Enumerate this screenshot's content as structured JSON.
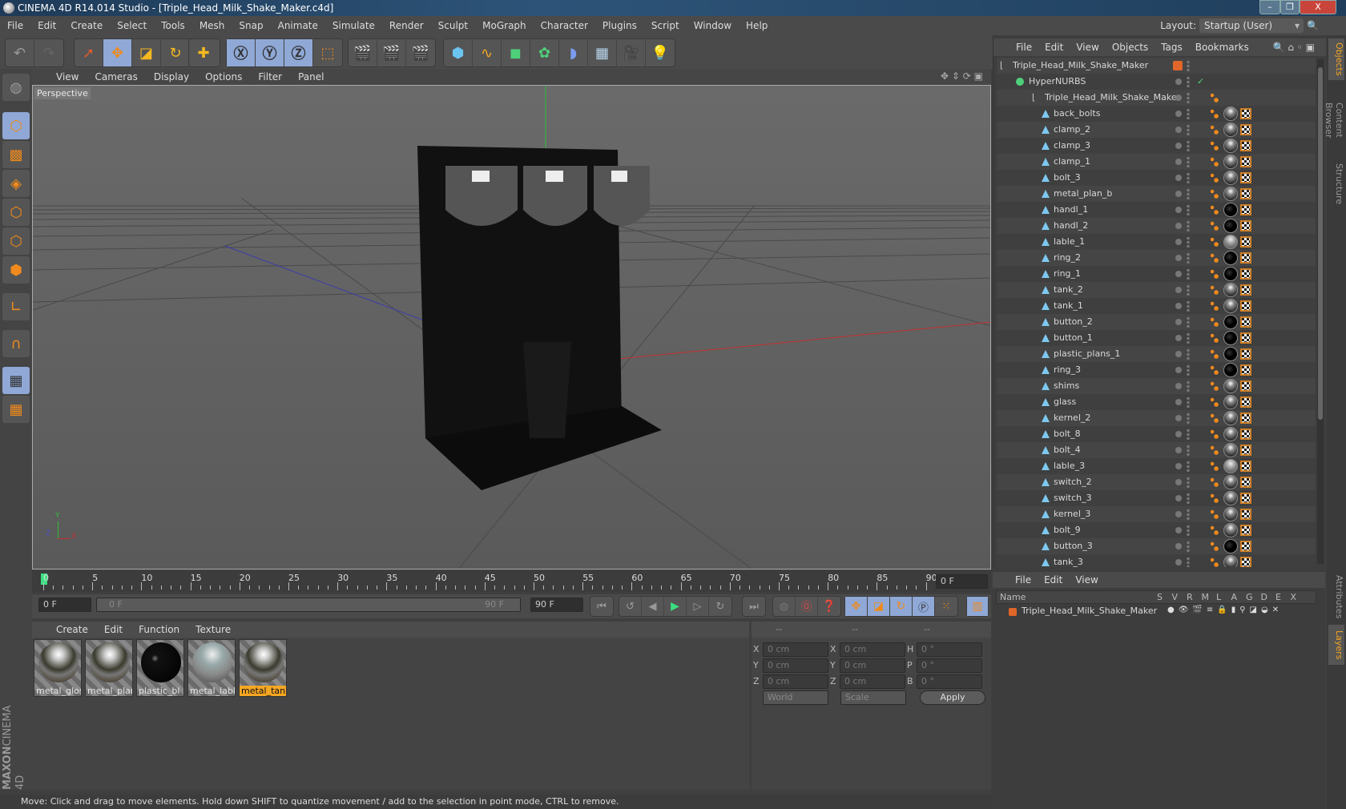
{
  "window": {
    "title": "CINEMA 4D R14.014 Studio - [Triple_Head_Milk_Shake_Maker.c4d]",
    "controls": [
      "minimize",
      "restore",
      "close"
    ]
  },
  "menubar": [
    "File",
    "Edit",
    "Create",
    "Select",
    "Tools",
    "Mesh",
    "Snap",
    "Animate",
    "Simulate",
    "Render",
    "Sculpt",
    "MoGraph",
    "Character",
    "Plugins",
    "Script",
    "Window",
    "Help"
  ],
  "layout": {
    "label": "Layout:",
    "value": "Startup (User)"
  },
  "toolbar": {
    "icons": [
      "undo-icon",
      "redo-icon",
      "live-selection-icon",
      "move-icon",
      "scale-icon",
      "rotate-icon",
      "add-icon",
      "x-axis-icon",
      "y-axis-icon",
      "z-axis-icon",
      "coordinate-system-icon",
      "render-view-icon",
      "render-picture-viewer-icon",
      "render-settings-icon",
      "cube-icon",
      "spline-icon",
      "nurbs-icon",
      "array-icon",
      "deformer-icon",
      "floor-icon",
      "camera-icon",
      "light-icon"
    ]
  },
  "viewport": {
    "menu": [
      "View",
      "Cameras",
      "Display",
      "Options",
      "Filter",
      "Panel"
    ],
    "label": "Perspective",
    "axes": {
      "x": "X",
      "y": "Y",
      "z": "Z"
    }
  },
  "timeline": {
    "ticks": [
      "0",
      "5",
      "10",
      "15",
      "20",
      "25",
      "30",
      "35",
      "40",
      "45",
      "50",
      "55",
      "60",
      "65",
      "70",
      "75",
      "80",
      "85",
      "90"
    ],
    "current": "0 F"
  },
  "transport": {
    "start": "0 F",
    "range_start": "0 F",
    "range_end": "90 F",
    "end": "90 F"
  },
  "materials": {
    "menu": [
      "Create",
      "Edit",
      "Function",
      "Texture"
    ],
    "items": [
      {
        "name": "metal_glos",
        "type": "chrome"
      },
      {
        "name": "metal_plan",
        "type": "chrome"
      },
      {
        "name": "plastic_bl",
        "type": "black"
      },
      {
        "name": "metal_lable",
        "type": "label"
      },
      {
        "name": "metal_tank",
        "type": "chrome",
        "selected": true
      }
    ]
  },
  "coords": {
    "headers": [
      "--",
      "--",
      "--"
    ],
    "rows": [
      {
        "a": "X",
        "av": "0 cm",
        "b": "X",
        "bv": "0 cm",
        "c": "H",
        "cv": "0 °"
      },
      {
        "a": "Y",
        "av": "0 cm",
        "b": "Y",
        "bv": "0 cm",
        "c": "P",
        "cv": "0 °"
      },
      {
        "a": "Z",
        "av": "0 cm",
        "b": "Z",
        "bv": "0 cm",
        "c": "B",
        "cv": "0 °"
      }
    ],
    "mode": "World",
    "type": "Scale",
    "apply": "Apply"
  },
  "objects": {
    "menu": [
      "File",
      "Edit",
      "View",
      "Objects",
      "Tags",
      "Bookmarks"
    ],
    "root": "Triple_Head_Milk_Shake_Maker",
    "nurbs": "HyperNURBS",
    "group": "Triple_Head_Milk_Shake_Maker",
    "items": [
      {
        "n": "back_bolts",
        "m": "chrome"
      },
      {
        "n": "clamp_2",
        "m": "chrome"
      },
      {
        "n": "clamp_3",
        "m": "chrome"
      },
      {
        "n": "clamp_1",
        "m": "chrome"
      },
      {
        "n": "bolt_3",
        "m": "chrome"
      },
      {
        "n": "metal_plan_b",
        "m": "chrome"
      },
      {
        "n": "handl_1",
        "m": "black"
      },
      {
        "n": "handl_2",
        "m": "black"
      },
      {
        "n": "lable_1",
        "m": "label"
      },
      {
        "n": "ring_2",
        "m": "black"
      },
      {
        "n": "ring_1",
        "m": "black"
      },
      {
        "n": "tank_2",
        "m": "chrome"
      },
      {
        "n": "tank_1",
        "m": "chrome"
      },
      {
        "n": "button_2",
        "m": "black"
      },
      {
        "n": "button_1",
        "m": "black"
      },
      {
        "n": "plastic_plans_1",
        "m": "black"
      },
      {
        "n": "ring_3",
        "m": "black"
      },
      {
        "n": "shims",
        "m": "chrome"
      },
      {
        "n": "glass",
        "m": "chrome"
      },
      {
        "n": "kernel_2",
        "m": "chrome"
      },
      {
        "n": "bolt_8",
        "m": "chrome"
      },
      {
        "n": "bolt_4",
        "m": "chrome"
      },
      {
        "n": "lable_3",
        "m": "label"
      },
      {
        "n": "switch_2",
        "m": "chrome"
      },
      {
        "n": "switch_3",
        "m": "chrome"
      },
      {
        "n": "kernel_3",
        "m": "chrome"
      },
      {
        "n": "bolt_9",
        "m": "chrome"
      },
      {
        "n": "button_3",
        "m": "black"
      },
      {
        "n": "tank_3",
        "m": "chrome"
      }
    ]
  },
  "layers": {
    "menu": [
      "File",
      "Edit",
      "View"
    ],
    "columns": [
      "Name",
      "S",
      "V",
      "R",
      "M",
      "L",
      "A",
      "G",
      "D",
      "E",
      "X"
    ],
    "rows": [
      {
        "name": "Triple_Head_Milk_Shake_Maker",
        "color": "#e0662a"
      }
    ]
  },
  "sidetabs": {
    "top": [
      "Objects",
      "Content Browser",
      "Structure"
    ],
    "bottom": [
      "Attributes",
      "Layers"
    ]
  },
  "status": "Move: Click and drag to move elements. Hold down SHIFT to quantize movement / add to the selection in point mode, CTRL to remove.",
  "brand": {
    "line1": "MAXON",
    "line2": "CINEMA 4D"
  },
  "colors": {
    "accent": "#f08a1c",
    "selected_tab": "#f5a623",
    "active_btn": "#8fa8d6"
  }
}
